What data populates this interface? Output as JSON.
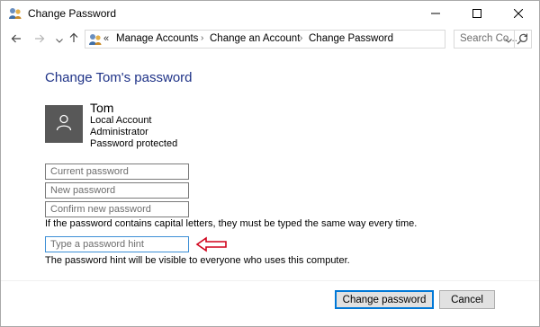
{
  "window": {
    "title": "Change Password",
    "icon": "user-accounts-icon"
  },
  "window_controls": {
    "minimize": "minimize-icon",
    "maximize": "maximize-icon",
    "close": "close-icon"
  },
  "nav": {
    "back": "back-arrow-icon",
    "forward": "forward-arrow-icon",
    "recent": "chevron-down-icon",
    "up": "up-arrow-icon"
  },
  "address": {
    "overflow": "«",
    "breadcrumbs": [
      "Manage Accounts",
      "Change an Account",
      "Change Password"
    ]
  },
  "search": {
    "placeholder": "Search Co..."
  },
  "main": {
    "heading": "Change Tom's password",
    "user": {
      "name": "Tom",
      "details": [
        "Local Account",
        "Administrator",
        "Password protected"
      ]
    },
    "fields": {
      "current_password": "Current password",
      "new_password": "New password",
      "confirm_password": "Confirm new password",
      "password_hint": "Type a password hint"
    },
    "capital_note": "If the password contains capital letters, they must be typed the same way every time.",
    "hint_note": "The password hint will be visible to everyone who uses this computer."
  },
  "buttons": {
    "change_password": "Change password",
    "cancel": "Cancel"
  },
  "colors": {
    "heading": "#1e3287",
    "avatar": "#585858",
    "focus": "#0078d7",
    "annotation_arrow": "#d0021b"
  }
}
